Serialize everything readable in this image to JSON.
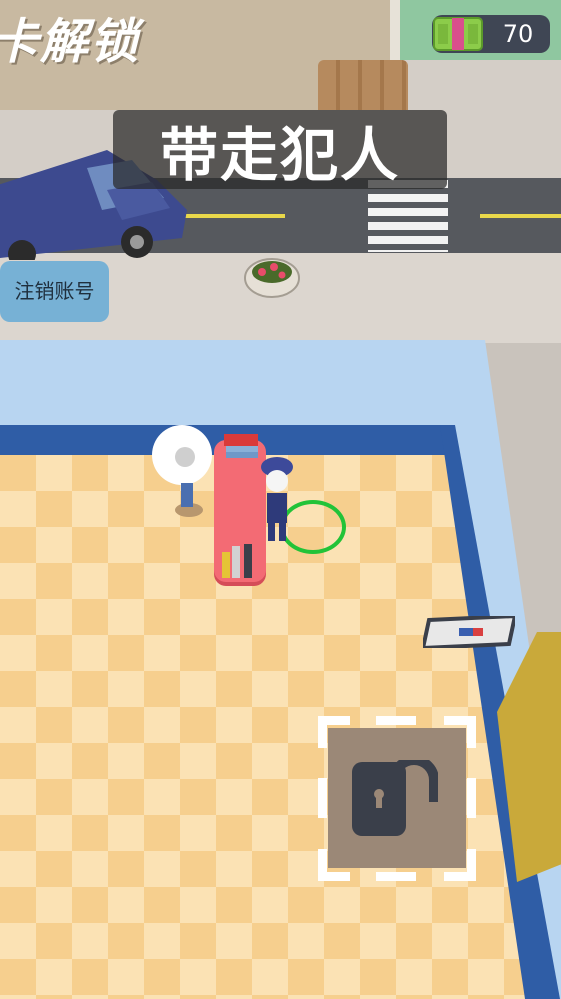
{
  "hud": {
    "banner_text": "卡解锁",
    "title": "带走犯人",
    "money": "70",
    "logout_button": "注销账号"
  },
  "colors": {
    "title_chip_bg": "#282828",
    "logout_button_bg": "#65aad6",
    "money_bg": "#3f4654",
    "floor_light": "#fbe2b4",
    "floor_dark": "#f6cf8e",
    "wall": "#b8d5f1",
    "wall_trim": "#2f5da6",
    "desk": "#f36b74",
    "target_ring": "#22c338"
  },
  "icons": {
    "money": "cash-stack-icon",
    "lock": "padlock-icon"
  }
}
